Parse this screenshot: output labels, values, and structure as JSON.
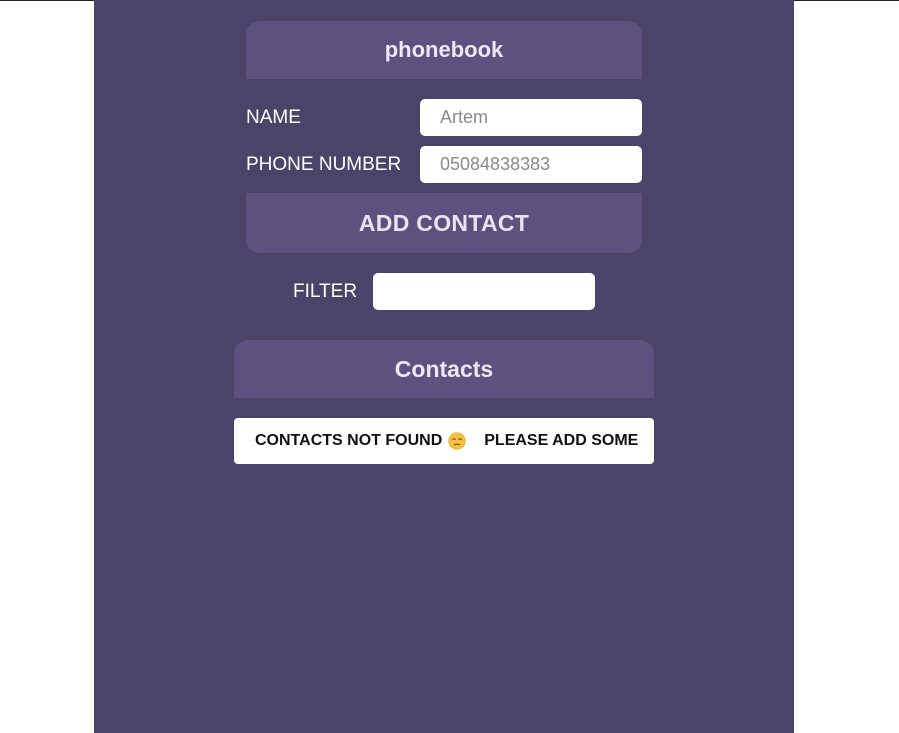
{
  "app": {
    "title": "phonebook",
    "form": {
      "name_label": "NAME",
      "name_placeholder": "Artem",
      "name_value": "",
      "phone_label": "PHONE NUMBER",
      "phone_placeholder": "05084838383",
      "phone_value": "",
      "add_button_label": "ADD CONTACT"
    },
    "filter": {
      "label": "FILTER",
      "value": ""
    },
    "contacts": {
      "title": "Contacts",
      "empty_message_part1": "CONTACTS NOT FOUND",
      "empty_emoji_icon": "unamused-face-icon",
      "empty_message_part2": "PLEASE ADD SOME"
    }
  },
  "colors": {
    "background": "#4c4468",
    "panel": "#5d517f",
    "header_text": "#ece8f4",
    "input_bg": "#ffffff"
  }
}
